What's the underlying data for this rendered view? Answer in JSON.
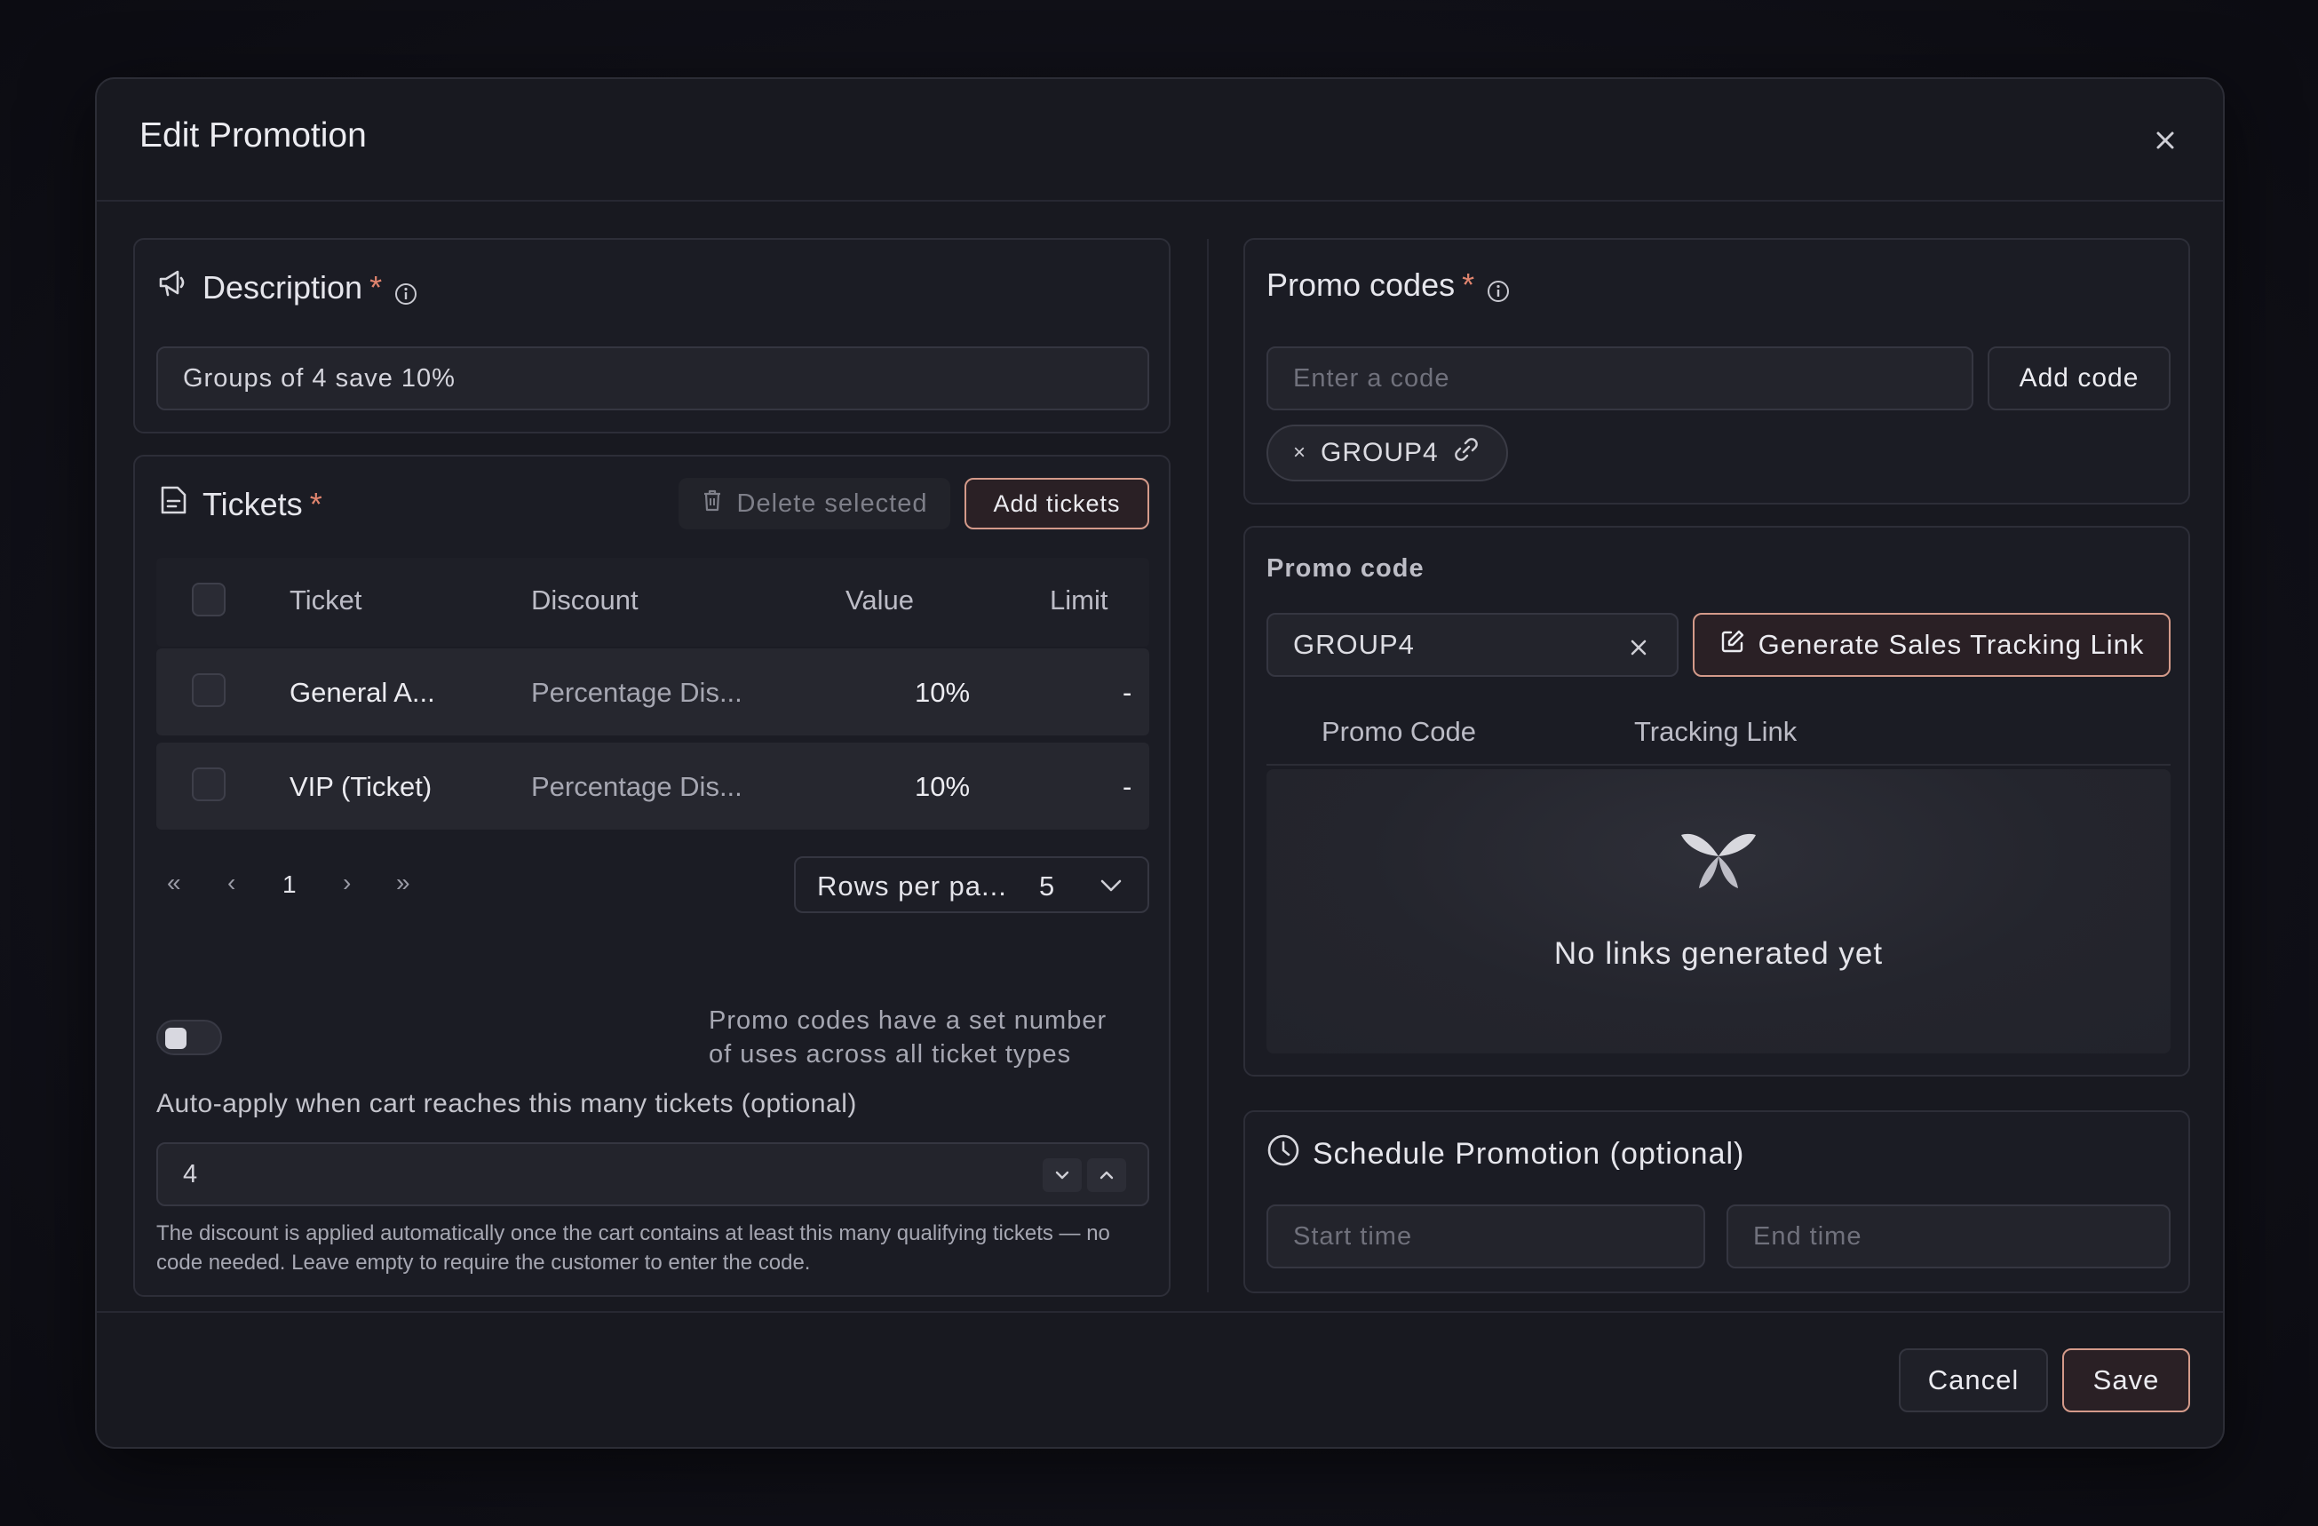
{
  "modal": {
    "title": "Edit Promotion"
  },
  "description": {
    "title": "Description",
    "required": "*",
    "value": "Groups of 4 save 10%"
  },
  "tickets": {
    "title": "Tickets",
    "required": "*",
    "delete_label": "Delete selected",
    "add_label": "Add tickets",
    "columns": [
      "Ticket",
      "Discount",
      "Value",
      "Limit"
    ],
    "rows": [
      {
        "ticket": "General A...",
        "discount": "Percentage Dis...",
        "value": "10%",
        "limit": "-"
      },
      {
        "ticket": "VIP (Ticket)",
        "discount": "Percentage Dis...",
        "value": "10%",
        "limit": "-"
      }
    ],
    "page": "1",
    "rows_per_page_label": "Rows per pa...",
    "rows_per_page_value": "5",
    "toggle_label_line1": "Promo codes have a set number",
    "toggle_label_line2": "of uses across all ticket types",
    "auto_apply_label": "Auto-apply when cart reaches this many tickets (optional)",
    "auto_apply_value": "4",
    "help_line1": "The discount is applied automatically once the cart contains at least this many qualifying tickets — no",
    "help_line2": "code needed. Leave empty to require the customer to enter the code."
  },
  "promo_codes": {
    "title": "Promo codes",
    "required": "*",
    "placeholder": "Enter a code",
    "add_label": "Add code",
    "chip": "GROUP4"
  },
  "promo_code_detail": {
    "title": "Promo code",
    "value": "GROUP4",
    "generate_label": "Generate Sales Tracking Link",
    "columns": [
      "Promo Code",
      "Tracking Link"
    ],
    "empty_text": "No links generated yet"
  },
  "schedule": {
    "title": "Schedule Promotion (optional)",
    "start_placeholder": "Start time",
    "end_placeholder": "End time"
  },
  "footer": {
    "cancel_label": "Cancel",
    "save_label": "Save"
  },
  "colors": {
    "accent": "#d49a8a",
    "required": "#e0846e",
    "background": "#181920"
  }
}
